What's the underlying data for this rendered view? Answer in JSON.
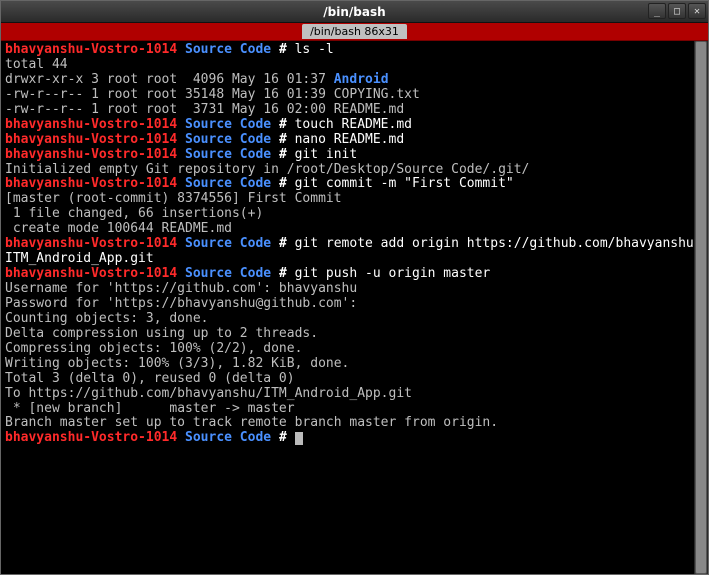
{
  "window": {
    "title": "/bin/bash",
    "controls": {
      "min": "_",
      "max": "□",
      "close": "✕"
    }
  },
  "tab": {
    "label": "/bin/bash 86x31"
  },
  "prompt": {
    "host": "bhavyanshu-Vostro-1014",
    "dir": "Source Code",
    "symbol": "#"
  },
  "lines": [
    {
      "t": "prompt",
      "cmd": "ls -l"
    },
    {
      "t": "out",
      "text": "total 44"
    },
    {
      "t": "out_dir",
      "prefix": "drwxr-xr-x 3 root root  4096 May 16 01:37 ",
      "dir": "Android"
    },
    {
      "t": "out",
      "text": "-rw-r--r-- 1 root root 35148 May 16 01:39 COPYING.txt"
    },
    {
      "t": "out",
      "text": "-rw-r--r-- 1 root root  3731 May 16 02:00 README.md"
    },
    {
      "t": "prompt",
      "cmd": "touch README.md"
    },
    {
      "t": "prompt",
      "cmd": "nano README.md"
    },
    {
      "t": "prompt",
      "cmd": "git init"
    },
    {
      "t": "out",
      "text": "Initialized empty Git repository in /root/Desktop/Source Code/.git/"
    },
    {
      "t": "prompt",
      "cmd": "git commit -m \"First Commit\""
    },
    {
      "t": "out",
      "text": "[master (root-commit) 8374556] First Commit"
    },
    {
      "t": "out",
      "text": " 1 file changed, 66 insertions(+)"
    },
    {
      "t": "out",
      "text": " create mode 100644 README.md"
    },
    {
      "t": "prompt",
      "cmd": "git remote add origin https://github.com/bhavyanshu/ITM_Android_App.git"
    },
    {
      "t": "prompt",
      "cmd": "git push -u origin master"
    },
    {
      "t": "out",
      "text": "Username for 'https://github.com': bhavyanshu"
    },
    {
      "t": "out",
      "text": "Password for 'https://bhavyanshu@github.com':"
    },
    {
      "t": "out",
      "text": "Counting objects: 3, done."
    },
    {
      "t": "out",
      "text": "Delta compression using up to 2 threads."
    },
    {
      "t": "out",
      "text": "Compressing objects: 100% (2/2), done."
    },
    {
      "t": "out",
      "text": "Writing objects: 100% (3/3), 1.82 KiB, done."
    },
    {
      "t": "out",
      "text": "Total 3 (delta 0), reused 0 (delta 0)"
    },
    {
      "t": "out",
      "text": "To https://github.com/bhavyanshu/ITM_Android_App.git"
    },
    {
      "t": "out",
      "text": " * [new branch]      master -> master"
    },
    {
      "t": "out",
      "text": "Branch master set up to track remote branch master from origin."
    },
    {
      "t": "prompt_cursor"
    }
  ]
}
